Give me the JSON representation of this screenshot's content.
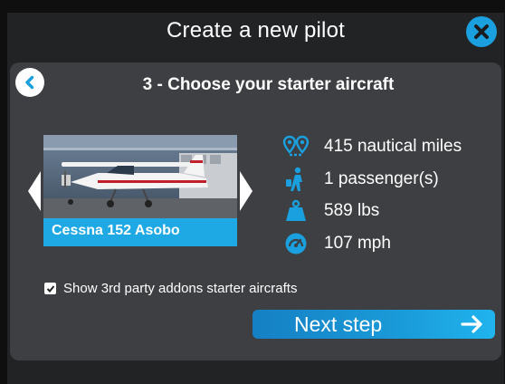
{
  "dialog": {
    "title": "Create a new pilot",
    "close_icon": "close-icon"
  },
  "step": {
    "title": "3 - Choose your starter aircraft",
    "back_icon": "chevron-left-icon"
  },
  "aircraft": {
    "name": "Cessna 152 Asobo",
    "prev_icon": "arrow-left-icon",
    "next_icon": "arrow-right-icon"
  },
  "stats": [
    {
      "icon": "range-pin-icon",
      "label": "415 nautical miles"
    },
    {
      "icon": "passenger-icon",
      "label": "1 passenger(s)"
    },
    {
      "icon": "weight-icon",
      "label": "589 lbs"
    },
    {
      "icon": "speedometer-icon",
      "label": "107 mph"
    }
  ],
  "options": {
    "show_3rd_party_label": "Show 3rd party addons starter aircrafts",
    "show_3rd_party_checked": true
  },
  "actions": {
    "next_label": "Next step"
  },
  "colors": {
    "accent": "#1aa0de",
    "panel": "#3d3f42",
    "dialog": "#222325",
    "name_bar": "#1ea8e4"
  }
}
